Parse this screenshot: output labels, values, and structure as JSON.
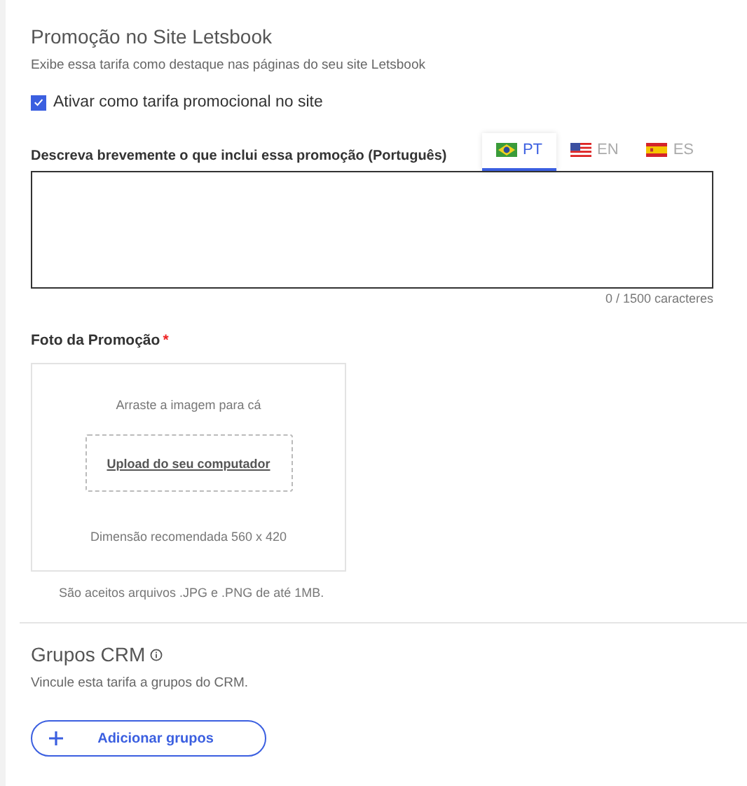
{
  "promo": {
    "title": "Promoção no Site Letsbook",
    "subtitle": "Exibe essa tarifa como destaque nas páginas do seu site Letsbook",
    "checkbox": {
      "label": "Ativar como tarifa promocional no site",
      "checked": true
    }
  },
  "description": {
    "label": "Descreva brevemente o que inclui essa promoção (Português)",
    "counter": "0 / 1500 caracteres"
  },
  "language_tabs": [
    {
      "kind": "br",
      "label": "PT",
      "selected": true
    },
    {
      "kind": "us",
      "label": "EN",
      "selected": false
    },
    {
      "kind": "es",
      "label": "ES",
      "selected": false
    }
  ],
  "photo": {
    "label": "Foto da Promoção",
    "required_mark": "*",
    "drop_hint": "Arraste a imagem para cá",
    "upload_link": "Upload do seu computador",
    "dimension": "Dimensão recomendada 560 x 420",
    "note": "São aceitos arquivos .JPG e .PNG de até 1MB."
  },
  "crm": {
    "title": "Grupos CRM",
    "subtitle": "Vincule esta tarifa a grupos do CRM.",
    "button": "Adicionar grupos"
  }
}
